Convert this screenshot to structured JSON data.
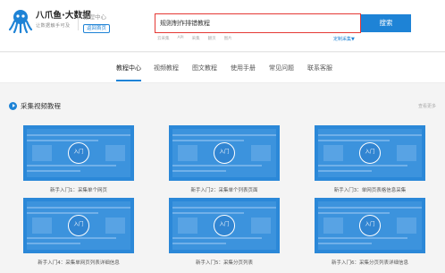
{
  "header": {
    "logo_name": "八爪鱼·大数据",
    "logo_slogan": "让数据触手可及",
    "sub_title": "教程中心",
    "home_button": "返回首页",
    "search": {
      "value": "规则制作排错教程",
      "button_label": "搜索"
    },
    "hot_words": [
      "云采集",
      "API",
      "采集",
      "翻页",
      "图片"
    ],
    "advanced_search": "定制采集▼"
  },
  "nav": {
    "items": [
      "教程中心",
      "视频教程",
      "图文教程",
      "使用手册",
      "常见问题",
      "联系客服"
    ],
    "active_index": 0
  },
  "section": {
    "title": "采集视频教程",
    "more": "查看更多"
  },
  "cards": [
    {
      "play_label": "入门",
      "caption": "新手入门1：采集单个网页"
    },
    {
      "play_label": "入门",
      "caption": "新手入门2：采集单个列表页面"
    },
    {
      "play_label": "入门",
      "caption": "新手入门3：单网页表格信息采集"
    },
    {
      "play_label": "入门",
      "caption": "新手入门4：采集单网页列表详细信息"
    },
    {
      "play_label": "入门",
      "caption": "新手入门5：采集分页列表"
    },
    {
      "play_label": "入门",
      "caption": "新手入门6：采集分页列表详细信息"
    }
  ],
  "colors": {
    "brand_blue": "#1e83d6",
    "search_highlight": "#e53935",
    "thumb_blue": "#2b88d8"
  },
  "icons": {
    "logo": "octopus-icon",
    "section": "play-circle-icon"
  }
}
